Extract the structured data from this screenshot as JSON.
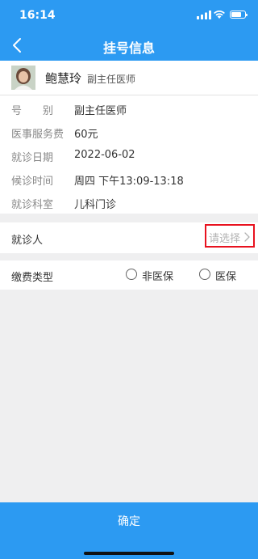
{
  "status_bar": {
    "time": "16:14"
  },
  "header": {
    "title": "挂号信息"
  },
  "doctor": {
    "name": "鲍慧玲",
    "title": "副主任医师"
  },
  "info": [
    {
      "label": "号　　别",
      "value": "副主任医师"
    },
    {
      "label": "医事服务费",
      "value": "60元"
    },
    {
      "label": "就诊日期",
      "value": "2022-06-02"
    },
    {
      "label": "候诊时间",
      "value": "周四 下午13:09-13:18"
    },
    {
      "label": "就诊科室",
      "value": "儿科门诊"
    }
  ],
  "patient": {
    "label": "就诊人",
    "placeholder": "请选择"
  },
  "payment": {
    "label": "缴费类型",
    "options": [
      {
        "label": "非医保",
        "selected": false
      },
      {
        "label": "医保",
        "selected": false
      }
    ]
  },
  "footer": {
    "confirm_label": "确定"
  },
  "colors": {
    "primary": "#2c9af2",
    "highlight_box": "#e8121f",
    "background": "#efeff0"
  }
}
